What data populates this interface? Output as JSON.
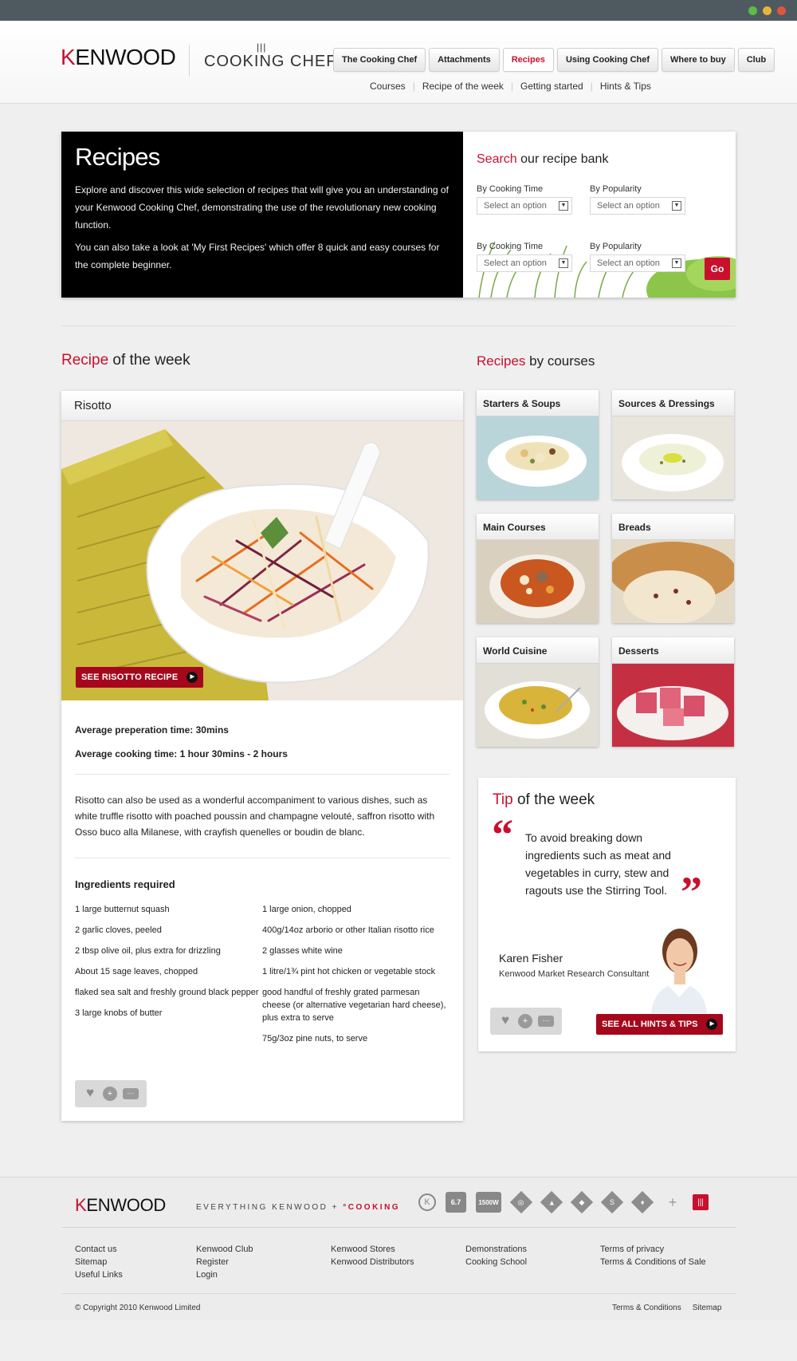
{
  "nav": {
    "brand": "KENWOOD",
    "product": "COOKING CHEF",
    "items": [
      {
        "label": "The Cooking Chef"
      },
      {
        "label": "Attachments"
      },
      {
        "label": "Recipes"
      },
      {
        "label": "Using Cooking Chef"
      },
      {
        "label": "Where to buy"
      },
      {
        "label": "Club"
      }
    ],
    "active": "Recipes",
    "subnav": [
      "Courses",
      "Recipe of the week",
      "Getting started",
      "Hints & Tips"
    ]
  },
  "hero": {
    "title": "Recipes",
    "p1": "Explore and discover this wide selection of recipes that will give you an understanding of your Kenwood Cooking Chef, demonstrating the use of the revolutionary new cooking function.",
    "p2": "You can also take a look at 'My First Recipes' which offer 8 quick and easy courses for the complete beginner.",
    "search_highlight": "Search",
    "search_rest": " our recipe bank",
    "filters": [
      {
        "label": "By Cooking Time",
        "placeholder": "Select an option"
      },
      {
        "label": "By Popularity",
        "placeholder": "Select an option"
      },
      {
        "label": "By Cooking Time",
        "placeholder": "Select an option"
      },
      {
        "label": "By Popularity",
        "placeholder": "Select an option"
      }
    ],
    "go": "Go"
  },
  "rotw": {
    "title_red": "Recipe",
    "title_rest": " of the week",
    "name": "Risotto",
    "cta": "SEE RISOTTO RECIPE",
    "prep": "Average preperation time: 30mins",
    "cook": "Average cooking time: 1 hour 30mins - 2 hours",
    "desc": "Risotto can also be used as a wonderful accompaniment to various dishes, such as white truffle risotto with poached poussin and champagne velouté, saffron risotto with Osso buco alla Milanese, with crayfish quenelles or boudin de blanc.",
    "ingredients_title": "Ingredients required",
    "ingredients_left": [
      "1 large butternut squash",
      "2 garlic cloves, peeled",
      "2 tbsp olive oil, plus extra for drizzling",
      "About 15 sage leaves, chopped",
      "flaked sea salt and freshly ground black pepper",
      "3 large knobs of butter"
    ],
    "ingredients_right": [
      "1 large onion, chopped",
      "400g/14oz arborio or other Italian risotto rice",
      "2 glasses white wine",
      "1 litre/1¾ pint hot chicken or vegetable stock",
      "good handful of freshly grated parmesan cheese (or alternative vegetarian hard cheese), plus extra to serve",
      "75g/3oz pine nuts, to serve"
    ]
  },
  "courses": {
    "title_red": "Recipes",
    "title_rest": " by courses",
    "items": [
      {
        "label": "Starters & Soups"
      },
      {
        "label": "Sources & Dressings"
      },
      {
        "label": "Main Courses"
      },
      {
        "label": "Breads"
      },
      {
        "label": "World Cuisine"
      },
      {
        "label": "Desserts"
      }
    ]
  },
  "tip": {
    "title_red": "Tip",
    "title_rest": " of the week",
    "text": "To avoid breaking down ingredients such as meat and vegetables in curry, stew and ragouts use the Stirring Tool.",
    "name": "Karen Fisher",
    "role": "Kenwood Market Research Consultant",
    "cta": "SEE ALL HINTS & TIPS"
  },
  "footer": {
    "brand": "KENWOOD",
    "tagline_main": "EVERYTHING  KENWOOD  +  ",
    "tagline_red": "°COOKING",
    "badges": [
      "K",
      "6.7",
      "1500W"
    ],
    "col1": [
      "Contact us",
      "Sitemap",
      "Useful Links"
    ],
    "col2": [
      "Kenwood Club",
      "Register",
      "Login"
    ],
    "col3": [
      "Kenwood Stores",
      "Kenwood Distributors"
    ],
    "col4": [
      "Demonstrations",
      "Cooking School"
    ],
    "col5": [
      "Terms of privacy",
      "Terms & Conditions of Sale"
    ],
    "copyright": "© Copyright 2010 Kenwood Limited",
    "bottom_links": [
      "Terms & Conditions",
      "Sitemap"
    ]
  }
}
